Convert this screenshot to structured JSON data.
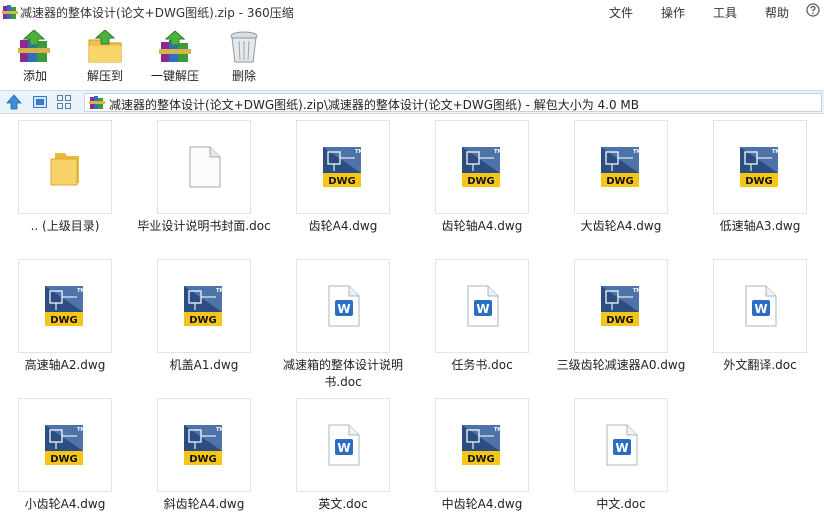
{
  "window": {
    "title": "减速器的整体设计(论文+DWG图纸).zip - 360压缩",
    "app_icon": "winrar-books-icon"
  },
  "menu": [
    "文件",
    "操作",
    "工具",
    "帮助"
  ],
  "toolbar": [
    {
      "label": "添加",
      "icon": "add-archive-icon"
    },
    {
      "label": "解压到",
      "icon": "extract-to-icon"
    },
    {
      "label": "一键解压",
      "icon": "one-click-extract-icon"
    },
    {
      "label": "删除",
      "icon": "trash-can-icon"
    }
  ],
  "address": {
    "path": "减速器的整体设计(论文+DWG图纸).zip\\减速器的整体设计(论文+DWG图纸) - 解包大小为 4.0 MB"
  },
  "files": [
    {
      "name": ".. (上级目录)",
      "type": "folder"
    },
    {
      "name": "毕业设计说明书封面.doc",
      "type": "blank"
    },
    {
      "name": "齿轮A4.dwg",
      "type": "dwg"
    },
    {
      "name": "齿轮轴A4.dwg",
      "type": "dwg"
    },
    {
      "name": "大齿轮A4.dwg",
      "type": "dwg"
    },
    {
      "name": "低速轴A3.dwg",
      "type": "dwg"
    },
    {
      "name": "高速轴A2.dwg",
      "type": "dwg"
    },
    {
      "name": "机盖A1.dwg",
      "type": "dwg"
    },
    {
      "name": "减速箱的整体设计说明书.doc",
      "type": "word"
    },
    {
      "name": "任务书.doc",
      "type": "word"
    },
    {
      "name": "三级齿轮减速器A0.dwg",
      "type": "dwg"
    },
    {
      "name": "外文翻译.doc",
      "type": "word"
    },
    {
      "name": "小齿轮A4.dwg",
      "type": "dwg"
    },
    {
      "name": "斜齿轮A4.dwg",
      "type": "dwg"
    },
    {
      "name": "英文.doc",
      "type": "word"
    },
    {
      "name": "中齿轮A4.dwg",
      "type": "dwg"
    },
    {
      "name": "中文.doc",
      "type": "word"
    }
  ],
  "dwg_badge": "DWG",
  "tm_mark": "TM",
  "word_letter": "W"
}
